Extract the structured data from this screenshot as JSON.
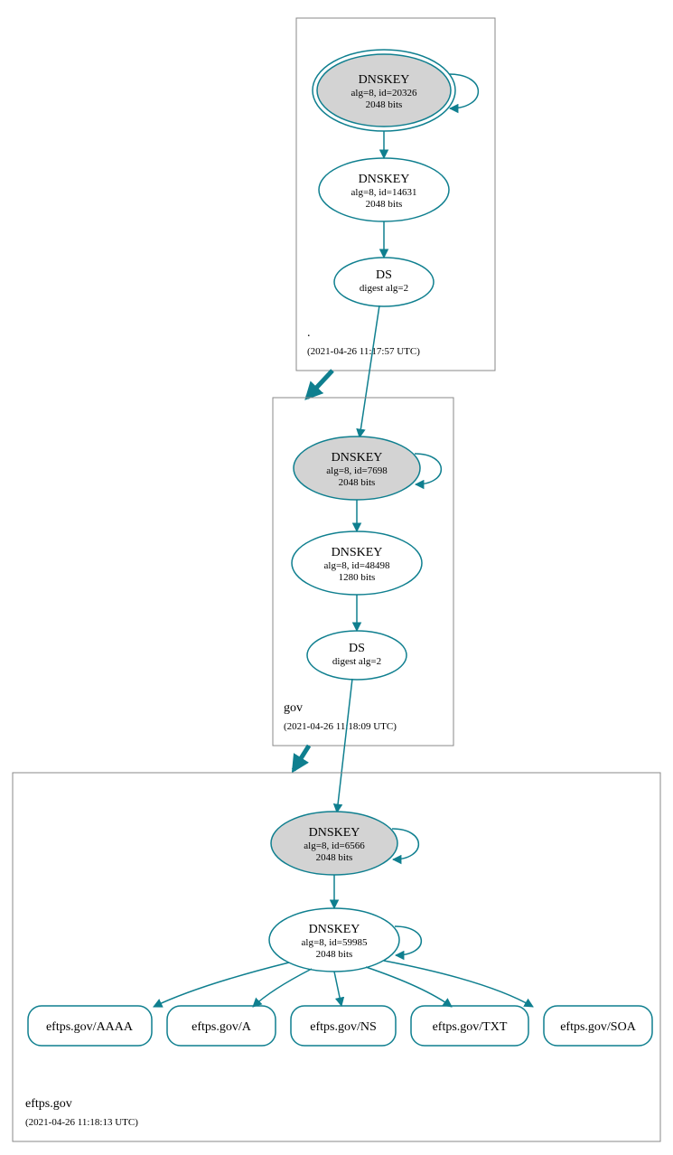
{
  "colors": {
    "teal": "#0f7f8f",
    "grey_fill": "#d3d3d3",
    "box_stroke": "#888888"
  },
  "zones": [
    {
      "id": "root",
      "name": ".",
      "timestamp": "(2021-04-26 11:17:57 UTC)",
      "nodes": [
        {
          "id": "root-ksk",
          "kind": "dnskey",
          "title": "DNSKEY",
          "line2": "alg=8, id=20326",
          "line3": "2048 bits",
          "grey": true,
          "trust_anchor": true,
          "self_loop": true
        },
        {
          "id": "root-zsk",
          "kind": "dnskey",
          "title": "DNSKEY",
          "line2": "alg=8, id=14631",
          "line3": "2048 bits",
          "grey": false,
          "trust_anchor": false,
          "self_loop": false
        },
        {
          "id": "root-ds",
          "kind": "ds",
          "title": "DS",
          "line2": "digest alg=2",
          "line3": "",
          "grey": false
        }
      ]
    },
    {
      "id": "gov",
      "name": "gov",
      "timestamp": "(2021-04-26 11:18:09 UTC)",
      "nodes": [
        {
          "id": "gov-ksk",
          "kind": "dnskey",
          "title": "DNSKEY",
          "line2": "alg=8, id=7698",
          "line3": "2048 bits",
          "grey": true,
          "self_loop": true
        },
        {
          "id": "gov-zsk",
          "kind": "dnskey",
          "title": "DNSKEY",
          "line2": "alg=8, id=48498",
          "line3": "1280 bits",
          "grey": false,
          "self_loop": false
        },
        {
          "id": "gov-ds",
          "kind": "ds",
          "title": "DS",
          "line2": "digest alg=2",
          "line3": "",
          "grey": false
        }
      ]
    },
    {
      "id": "eftps",
      "name": "eftps.gov",
      "timestamp": "(2021-04-26 11:18:13 UTC)",
      "nodes": [
        {
          "id": "eftps-ksk",
          "kind": "dnskey",
          "title": "DNSKEY",
          "line2": "alg=8, id=6566",
          "line3": "2048 bits",
          "grey": true,
          "self_loop": true
        },
        {
          "id": "eftps-zsk",
          "kind": "dnskey",
          "title": "DNSKEY",
          "line2": "alg=8, id=59985",
          "line3": "2048 bits",
          "grey": false,
          "self_loop": true
        }
      ],
      "rrsets": [
        {
          "label": "eftps.gov/AAAA"
        },
        {
          "label": "eftps.gov/A"
        },
        {
          "label": "eftps.gov/NS"
        },
        {
          "label": "eftps.gov/TXT"
        },
        {
          "label": "eftps.gov/SOA"
        }
      ]
    }
  ]
}
